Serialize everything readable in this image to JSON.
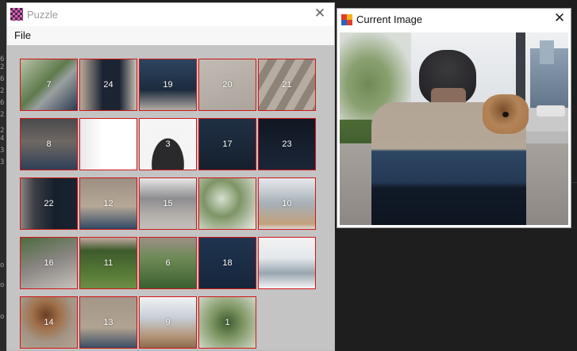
{
  "puzzle_window": {
    "title": "Puzzle",
    "menu": [
      "File"
    ],
    "tiles": [
      {
        "label": "7",
        "bg": "linear-gradient(135deg,#b8c3a8 0%,#5f7a4c 45%,#9aa0a0 60%,#2c3b52 100%)"
      },
      {
        "label": "24",
        "bg": "linear-gradient(90deg,#b9aa9a 0%,#1b2433 40%,#1b2433 70%,#c8c0b6 100%)"
      },
      {
        "label": "19",
        "bg": "linear-gradient(180deg,#2d4560 0%,#1c2b3e 60%,#b3aca5 100%)"
      },
      {
        "label": "20",
        "bg": "linear-gradient(160deg,#c2bbb3 0%,#aba49c 100%)"
      },
      {
        "label": "21",
        "bg": "repeating-linear-gradient(120deg,#b7aca2 0 10px,#8e8378 10px 20px)"
      },
      {
        "label": "8",
        "bg": "linear-gradient(180deg,#4a4a4d 0%,#6f6863 45%,#2f4058 100%)"
      },
      {
        "label": "",
        "bg": "linear-gradient(90deg,#e8e8e8 0%,#ffffff 40%,#ffffff 100%)"
      },
      {
        "label": "3",
        "bg": "radial-gradient(ellipse at 50% 90%,#2a2a2c 0%,#2a2a2c 40%,#f4f4f4 41%,#f6f6f6 100%)"
      },
      {
        "label": "17",
        "bg": "linear-gradient(180deg,#1f3044 0%,#15202e 100%)"
      },
      {
        "label": "23",
        "bg": "linear-gradient(180deg,#111722 0%,#1b2638 100%)"
      },
      {
        "label": "22",
        "bg": "linear-gradient(90deg,#8a8581 0%,#3a3d44 25%,#15202c 60%,#1a2330 100%)"
      },
      {
        "label": "12",
        "bg": "linear-gradient(180deg,#9c8f82 0%,#b6a897 55%,#2f4865 100%)"
      },
      {
        "label": "15",
        "bg": "linear-gradient(180deg,#e6e6e6 0%,#8d8d90 40%,#b0aca8 70%,#c4c0bc 100%)"
      },
      {
        "label": "",
        "bg": "radial-gradient(circle at 40% 40%,#d7e0d0 0%,#7e9466 40%,#e8ece6 100%)"
      },
      {
        "label": "10",
        "bg": "linear-gradient(180deg,#e6e8ec 0%,#a6b0b8 50%,#c2a17c 90%,#dadada 100%)"
      },
      {
        "label": "16",
        "bg": "linear-gradient(160deg,#4e6b3e 0%,#8a8784 50%,#c6c0b9 100%)"
      },
      {
        "label": "11",
        "bg": "linear-gradient(180deg,#c0a8a0 0%,#3e5a2c 25%,#567a36 70%,#6d8d46 100%)"
      },
      {
        "label": "6",
        "bg": "linear-gradient(180deg,#9c8f86 0%,#6d8a55 40%,#3c5f30 100%)"
      },
      {
        "label": "18",
        "bg": "linear-gradient(180deg,#1f3450 0%,#16263b 100%)"
      },
      {
        "label": "",
        "bg": "linear-gradient(180deg,#f2f2f2 0%,#e4e8ec 40%,#9aa5b0 70%,#f5f5f5 100%)"
      },
      {
        "label": "14",
        "bg": "radial-gradient(circle at 45% 35%,#6a3e22 0%,#a0704a 30%,#a39484 60%,#b2a597 100%)"
      },
      {
        "label": "13",
        "bg": "linear-gradient(180deg,#a49688 0%,#b1a392 60%,#3a4d64 100%)"
      },
      {
        "label": "9",
        "bg": "linear-gradient(180deg,#f2f2f2 0%,#c7cfd8 40%,#b09072 80%,#8a6a4e 100%)"
      },
      {
        "label": "1",
        "bg": "radial-gradient(circle at 50% 50%,#3e5a30 0%,#7c9460 40%,#cfd8c8 100%)"
      }
    ]
  },
  "current_window": {
    "title": "Current Image"
  },
  "colors": {
    "tile_border": "#d01515",
    "client_bg": "#c4c4c4",
    "dark_bg": "#1e1e1e"
  },
  "icons": {
    "puzzle_app": "puzzle-app-icon",
    "current_app": "image-window-icon",
    "close": "close-icon"
  }
}
